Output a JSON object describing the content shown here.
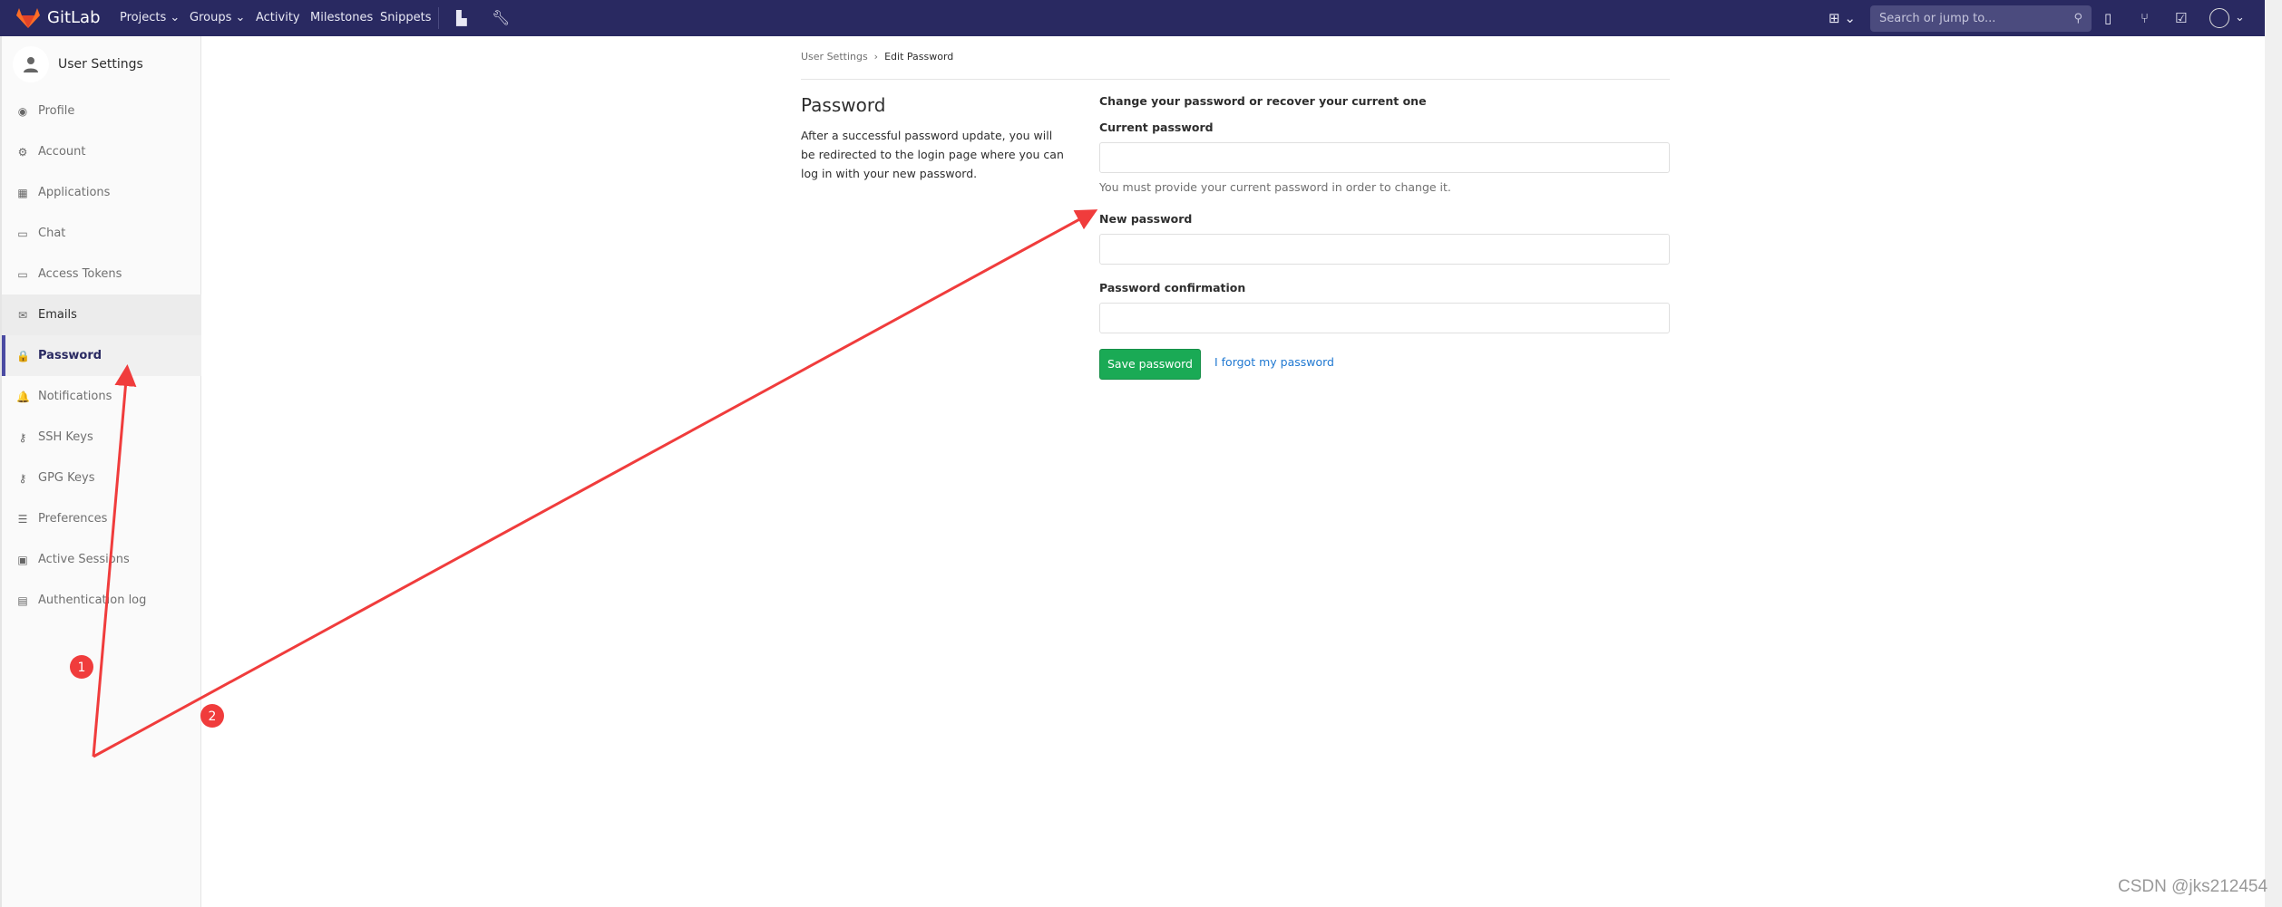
{
  "navbar": {
    "brand": "GitLab",
    "items": [
      "Projects ⌄",
      "Groups ⌄",
      "Activity",
      "Milestones",
      "Snippets"
    ],
    "search_placeholder": "Search or jump to...",
    "bg": "#292961"
  },
  "sidebar": {
    "title": "User Settings",
    "items": [
      {
        "label": "Profile",
        "icon": "profile-icon",
        "glyph": "◉"
      },
      {
        "label": "Account",
        "icon": "account-icon",
        "glyph": "⚙"
      },
      {
        "label": "Applications",
        "icon": "applications-icon",
        "glyph": "▦"
      },
      {
        "label": "Chat",
        "icon": "chat-icon",
        "glyph": "▭"
      },
      {
        "label": "Access Tokens",
        "icon": "token-icon",
        "glyph": "▭"
      },
      {
        "label": "Emails",
        "icon": "envelope-icon",
        "glyph": "✉"
      },
      {
        "label": "Password",
        "icon": "lock-icon",
        "glyph": "🔒"
      },
      {
        "label": "Notifications",
        "icon": "bell-icon",
        "glyph": "🔔"
      },
      {
        "label": "SSH Keys",
        "icon": "key-icon",
        "glyph": "⚷"
      },
      {
        "label": "GPG Keys",
        "icon": "key-icon",
        "glyph": "⚷"
      },
      {
        "label": "Preferences",
        "icon": "sliders-icon",
        "glyph": "☰"
      },
      {
        "label": "Active Sessions",
        "icon": "monitor-icon",
        "glyph": "▣"
      },
      {
        "label": "Authentication log",
        "icon": "log-icon",
        "glyph": "▤"
      }
    ],
    "active": "Password"
  },
  "breadcrumb": {
    "parent": "User Settings",
    "current": "Edit Password"
  },
  "section": {
    "title": "Password",
    "description": "After a successful password update, you will be redirected to the login page where you can log in with your new password."
  },
  "form": {
    "heading": "Change your password or recover your current one",
    "current_label": "Current password",
    "current_value": "",
    "current_help": "You must provide your current password in order to change it.",
    "new_label": "New password",
    "new_value": "",
    "confirm_label": "Password confirmation",
    "confirm_value": "",
    "save_label": "Save password",
    "forgot_label": "I forgot my password"
  },
  "annotations": {
    "badge1": "1",
    "badge2": "2",
    "color": "#f03c3c"
  },
  "watermark": "CSDN @jks212454"
}
